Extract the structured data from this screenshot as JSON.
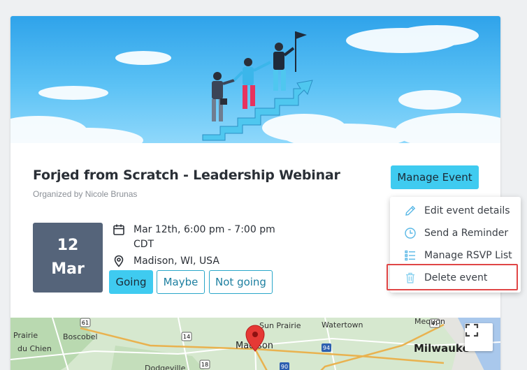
{
  "event": {
    "title": "Forjed from Scratch - Leadership Webinar",
    "organizer": "Organized by Nicole Brunas",
    "date_day": "12",
    "date_month": "Mar",
    "time_line1": "Mar 12th, 6:00 pm - 7:00 pm",
    "time_line2": "CDT",
    "location": "Madison, WI, USA"
  },
  "manage_button": "Manage Event",
  "rsvp": {
    "going": "Going",
    "maybe": "Maybe",
    "not_going": "Not going",
    "selected": "Going"
  },
  "menu": {
    "items": [
      {
        "label": "Edit event details",
        "icon": "pencil-icon"
      },
      {
        "label": "Send a Reminder",
        "icon": "clock-icon"
      },
      {
        "label": "Manage RSVP List",
        "icon": "list-icon"
      },
      {
        "label": "Delete event",
        "icon": "trash-icon"
      }
    ]
  },
  "map": {
    "labels": {
      "sun_prairie": "Sun Prairie",
      "watertown": "Watertown",
      "mequon": "Mequon",
      "prairie": "Prairie",
      "du_chien": "du Chien",
      "boscobel": "Boscobel",
      "madison": "Madison",
      "milwaukee": "Milwauke",
      "dodgeville": "Dodgeville"
    },
    "shields": [
      "61",
      "14",
      "94",
      "18",
      "90",
      "41",
      "94"
    ]
  },
  "colors": {
    "accent": "#3fcbf0",
    "date_box": "#55647a",
    "highlight": "#e04646",
    "marker": "#e53935"
  }
}
